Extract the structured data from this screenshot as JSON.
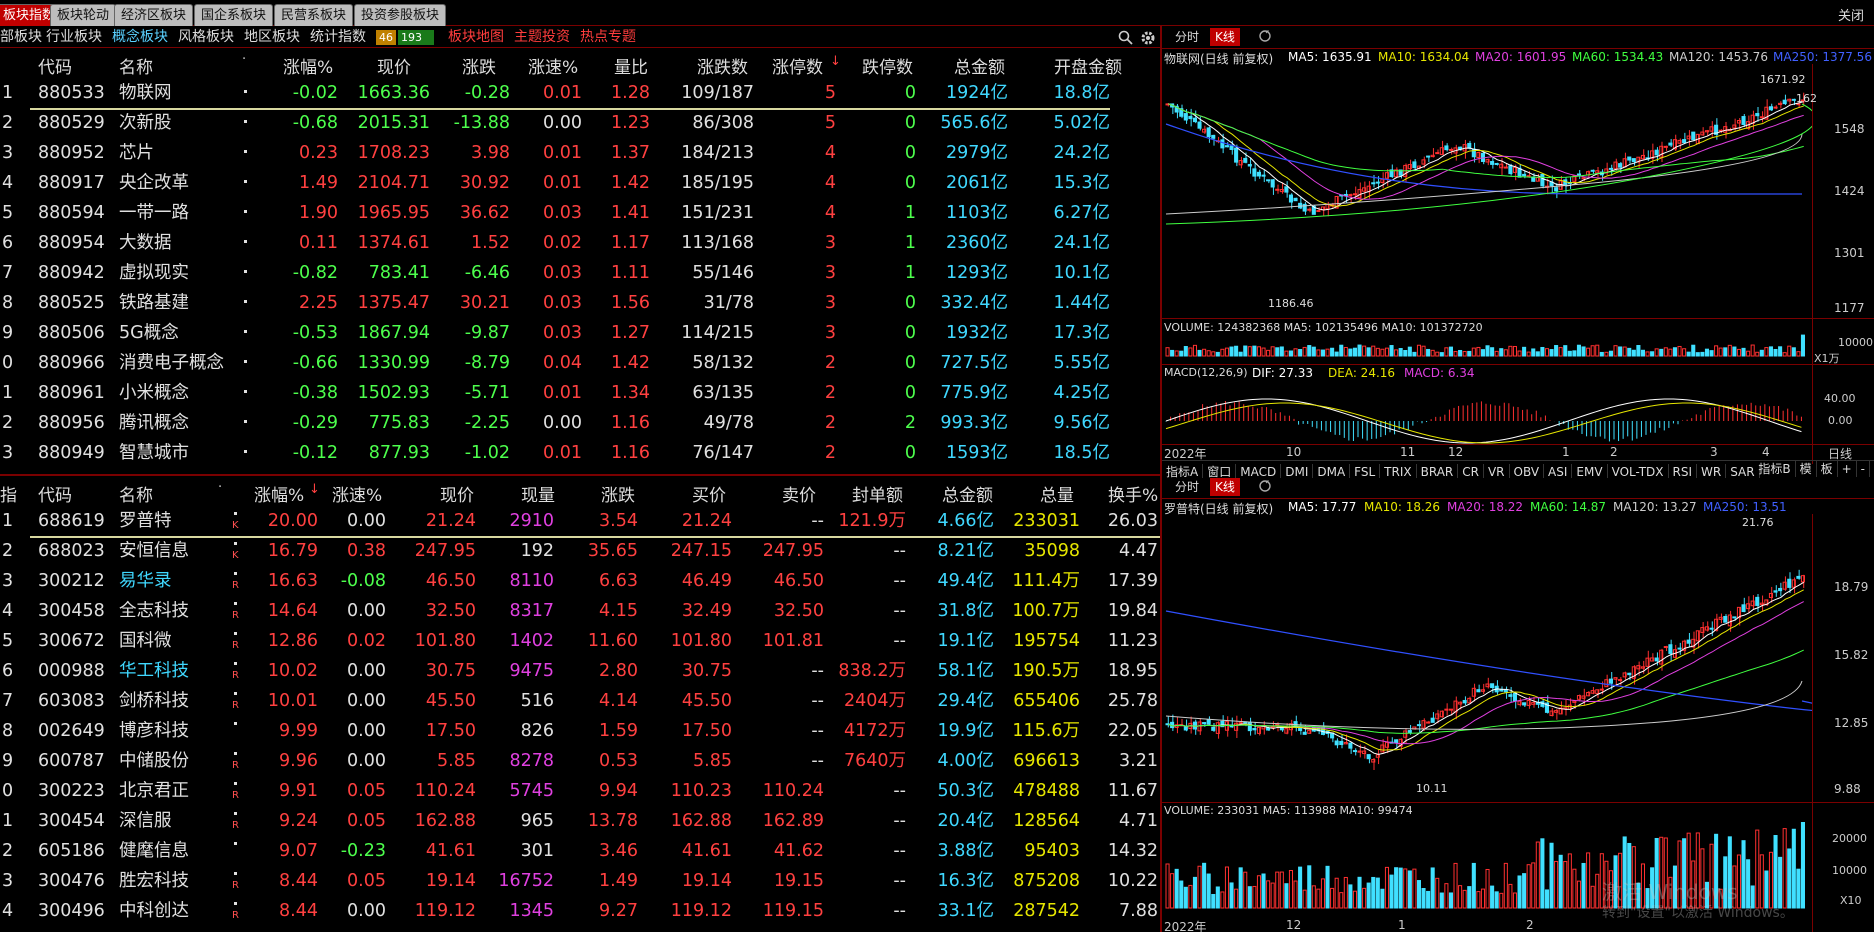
{
  "top_tabs": [
    "板块指数",
    "板块轮动",
    "经济区板块",
    "国企系板块",
    "民营系板块",
    "投资参股板块"
  ],
  "close_label": "关闭",
  "sub_tabs": [
    "部板块",
    "行业板块",
    "概念板块",
    "风格板块",
    "地区板块",
    "统计指数"
  ],
  "counts": {
    "up": "46",
    "down": "193"
  },
  "links": [
    "板块地图",
    "主题投资",
    "热点专题"
  ],
  "sector_table": {
    "headers": [
      "代码",
      "名称",
      "涨幅%",
      "现价",
      "涨跌",
      "涨速%",
      "量比",
      "涨跌数",
      "涨停数",
      "跌停数",
      "总金额",
      "开盘金额"
    ],
    "rows": [
      [
        "1",
        "880533",
        "物联网",
        "-0.02",
        "1663.36",
        "-0.28",
        "0.01",
        "1.28",
        "109/187",
        "5",
        "0",
        "1924亿",
        "18.8亿"
      ],
      [
        "2",
        "880529",
        "次新股",
        "-0.68",
        "2015.31",
        "-13.88",
        "0.00",
        "1.23",
        "86/308",
        "5",
        "0",
        "565.6亿",
        "5.02亿"
      ],
      [
        "3",
        "880952",
        "芯片",
        "0.23",
        "1708.23",
        "3.98",
        "0.01",
        "1.37",
        "184/213",
        "4",
        "0",
        "2979亿",
        "24.2亿"
      ],
      [
        "4",
        "880917",
        "央企改革",
        "1.49",
        "2104.71",
        "30.92",
        "0.01",
        "1.42",
        "185/195",
        "4",
        "0",
        "2061亿",
        "15.3亿"
      ],
      [
        "5",
        "880594",
        "一带一路",
        "1.90",
        "1965.95",
        "36.62",
        "0.03",
        "1.41",
        "151/231",
        "4",
        "1",
        "1103亿",
        "6.27亿"
      ],
      [
        "6",
        "880954",
        "大数据",
        "0.11",
        "1374.61",
        "1.52",
        "0.02",
        "1.17",
        "113/168",
        "3",
        "1",
        "2360亿",
        "24.1亿"
      ],
      [
        "7",
        "880942",
        "虚拟现实",
        "-0.82",
        "783.41",
        "-6.46",
        "0.03",
        "1.11",
        "55/146",
        "3",
        "1",
        "1293亿",
        "10.1亿"
      ],
      [
        "8",
        "880525",
        "铁路基建",
        "2.25",
        "1375.47",
        "30.21",
        "0.03",
        "1.56",
        "31/78",
        "3",
        "0",
        "332.4亿",
        "1.44亿"
      ],
      [
        "9",
        "880506",
        "5G概念",
        "-0.53",
        "1867.94",
        "-9.87",
        "0.03",
        "1.27",
        "114/215",
        "3",
        "0",
        "1932亿",
        "17.3亿"
      ],
      [
        "0",
        "880966",
        "消费电子概念",
        "-0.66",
        "1330.99",
        "-8.79",
        "0.04",
        "1.42",
        "58/132",
        "2",
        "0",
        "727.5亿",
        "5.55亿"
      ],
      [
        "1",
        "880961",
        "小米概念",
        "-0.38",
        "1502.93",
        "-5.71",
        "0.01",
        "1.34",
        "63/135",
        "2",
        "0",
        "775.9亿",
        "4.25亿"
      ],
      [
        "2",
        "880956",
        "腾讯概念",
        "-0.29",
        "775.83",
        "-2.25",
        "0.00",
        "1.16",
        "49/78",
        "2",
        "2",
        "993.3亿",
        "9.56亿"
      ],
      [
        "3",
        "880949",
        "智慧城市",
        "-0.12",
        "877.93",
        "-1.02",
        "0.01",
        "1.16",
        "76/147",
        "2",
        "0",
        "1593亿",
        "18.5亿"
      ]
    ]
  },
  "stock_table": {
    "corner": "指",
    "headers": [
      "代码",
      "名称",
      "涨幅%",
      "涨速%",
      "现价",
      "现量",
      "涨跌",
      "买价",
      "卖价",
      "封单额",
      "总金额",
      "总量",
      "换手%"
    ],
    "rows": [
      [
        "1",
        "688619",
        "罗普特",
        "K",
        "20.00",
        "0.00",
        "21.24",
        "2910",
        "3.54",
        "21.24",
        "--",
        "121.9万",
        "4.66亿",
        "233031",
        "26.03"
      ],
      [
        "2",
        "688023",
        "安恒信息",
        "K",
        "16.79",
        "0.38",
        "247.95",
        "192",
        "35.65",
        "247.15",
        "247.95",
        "--",
        "8.21亿",
        "35098",
        "4.47"
      ],
      [
        "3",
        "300212",
        "易华录",
        "R",
        "16.63",
        "-0.08",
        "46.50",
        "8110",
        "6.63",
        "46.49",
        "46.50",
        "--",
        "49.4亿",
        "111.4万",
        "17.39"
      ],
      [
        "4",
        "300458",
        "全志科技",
        "R",
        "14.64",
        "0.00",
        "32.50",
        "8317",
        "4.15",
        "32.49",
        "32.50",
        "--",
        "31.8亿",
        "100.7万",
        "19.84"
      ],
      [
        "5",
        "300672",
        "国科微",
        "R",
        "12.86",
        "0.02",
        "101.80",
        "1402",
        "11.60",
        "101.80",
        "101.81",
        "--",
        "19.1亿",
        "195754",
        "11.23"
      ],
      [
        "6",
        "000988",
        "华工科技",
        "R",
        "10.02",
        "0.00",
        "30.75",
        "9475",
        "2.80",
        "30.75",
        "--",
        "838.2万",
        "58.1亿",
        "190.5万",
        "18.95"
      ],
      [
        "7",
        "603083",
        "剑桥科技",
        "R",
        "10.01",
        "0.00",
        "45.50",
        "516",
        "4.14",
        "45.50",
        "--",
        "2404万",
        "29.4亿",
        "655406",
        "25.78"
      ],
      [
        "8",
        "002649",
        "博彦科技",
        "",
        "9.99",
        "0.00",
        "17.50",
        "826",
        "1.59",
        "17.50",
        "--",
        "4172万",
        "19.9亿",
        "115.6万",
        "22.05"
      ],
      [
        "9",
        "600787",
        "中储股份",
        "R",
        "9.96",
        "0.00",
        "5.85",
        "8278",
        "0.53",
        "5.85",
        "--",
        "7640万",
        "4.00亿",
        "696613",
        "3.21"
      ],
      [
        "0",
        "300223",
        "北京君正",
        "R",
        "9.91",
        "0.05",
        "110.24",
        "5745",
        "9.94",
        "110.23",
        "110.24",
        "--",
        "50.3亿",
        "478488",
        "11.67"
      ],
      [
        "1",
        "300454",
        "深信服",
        "R",
        "9.24",
        "0.05",
        "162.88",
        "965",
        "13.78",
        "162.88",
        "162.89",
        "--",
        "20.4亿",
        "128564",
        "4.71"
      ],
      [
        "2",
        "605186",
        "健麾信息",
        "",
        "9.07",
        "-0.23",
        "41.61",
        "301",
        "3.46",
        "41.61",
        "41.62",
        "--",
        "3.88亿",
        "95403",
        "14.32"
      ],
      [
        "3",
        "300476",
        "胜宏科技",
        "R",
        "8.44",
        "0.05",
        "19.14",
        "16752",
        "1.49",
        "19.14",
        "19.15",
        "--",
        "16.3亿",
        "875208",
        "10.22"
      ],
      [
        "4",
        "300496",
        "中科创达",
        "R",
        "8.44",
        "0.00",
        "119.12",
        "1345",
        "9.27",
        "119.12",
        "119.15",
        "--",
        "33.1亿",
        "287542",
        "7.88"
      ]
    ]
  },
  "chart1": {
    "tabs": [
      "分时",
      "K线"
    ],
    "title": "物联网(日线 前复权)",
    "ma": [
      {
        "label": "MA5: 1635.91",
        "color": "#ffffff"
      },
      {
        "label": "MA10: 1634.04",
        "color": "#e6e600"
      },
      {
        "label": "MA20: 1601.95",
        "color": "#e040e0"
      },
      {
        "label": "MA60: 1534.43",
        "color": "#40ff40"
      },
      {
        "label": "MA120: 1453.76",
        "color": "#cccccc"
      },
      {
        "label": "MA250: 1377.56",
        "color": "#4060ff"
      }
    ],
    "high_label": "1671.92",
    "low_label": "1186.46",
    "ylabels": [
      "1548",
      "1424",
      "1301",
      "1177"
    ],
    "last_label": "162",
    "volume": "VOLUME: 124382368  MA5: 102135496  MA10: 101372720",
    "vol_ylabels": [
      "10000",
      "X1万"
    ],
    "macd_title": "MACD(12,26,9)",
    "macd": [
      {
        "label": "DIF: 27.33",
        "color": "#ffffff"
      },
      {
        "label": "DEA: 24.16",
        "color": "#e6e600"
      },
      {
        "label": "MACD: 6.34",
        "color": "#e040e0"
      }
    ],
    "macd_ylabels": [
      "40.00",
      "0.00"
    ],
    "xlabels": [
      "2022年",
      "10",
      "11",
      "12",
      "1",
      "2",
      "3",
      "4"
    ],
    "period": "日线",
    "indicators": [
      "指标A",
      "窗口",
      "MACD",
      "DMI",
      "DMA",
      "FSL",
      "TRIX",
      "BRAR",
      "CR",
      "VR",
      "OBV",
      "ASI",
      "EMV",
      "VOL-TDX",
      "RSI",
      "WR",
      "SAR"
    ],
    "indicators_right": [
      "指标B",
      "模",
      "板",
      "+",
      "-"
    ]
  },
  "chart2": {
    "tabs": [
      "分时",
      "K线"
    ],
    "title": "罗普特(日线 前复权)",
    "ma": [
      {
        "label": "MA5: 17.77",
        "color": "#ffffff"
      },
      {
        "label": "MA10: 18.26",
        "color": "#e6e600"
      },
      {
        "label": "MA20: 18.22",
        "color": "#e040e0"
      },
      {
        "label": "MA60: 14.87",
        "color": "#40ff40"
      },
      {
        "label": "MA120: 13.27",
        "color": "#cccccc"
      },
      {
        "label": "MA250: 13.51",
        "color": "#4060ff"
      }
    ],
    "high_label": "21.76",
    "low_label": "10.11",
    "ylabels": [
      "18.79",
      "15.82",
      "12.85",
      "9.88"
    ],
    "volume": "VOLUME: 233031  MA5: 113988  MA10: 99474",
    "vol_ylabels": [
      "20000",
      "10000",
      "X10"
    ],
    "xlabels": [
      "2022年",
      "12",
      "1",
      "2"
    ],
    "watermark": "激活 Windows",
    "watermark2": "转到\"设置\"以激活 Windows。"
  }
}
